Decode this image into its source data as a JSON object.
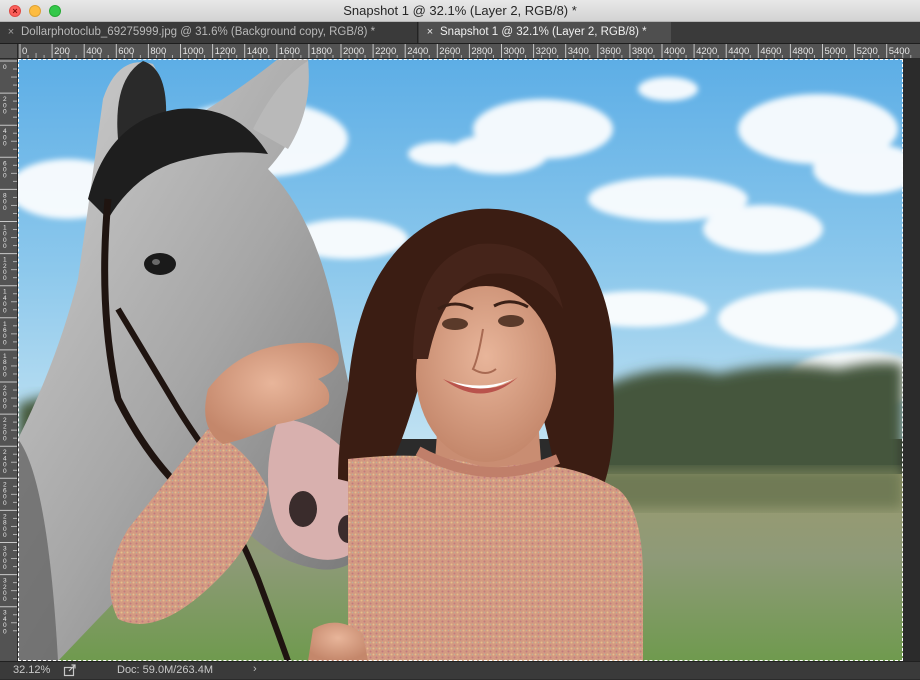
{
  "window": {
    "title": "Snapshot 1 @ 32.1% (Layer 2, RGB/8) *"
  },
  "tabs": [
    {
      "label": "Dollarphotoclub_69275999.jpg @ 31.6% (Background copy, RGB/8) *",
      "active": false
    },
    {
      "label": "Snapshot 1 @ 32.1% (Layer 2, RGB/8) *",
      "active": true
    }
  ],
  "ruler": {
    "horizontal_labels": [
      "0",
      "200",
      "400",
      "600",
      "800",
      "1000",
      "1200",
      "1400",
      "1600",
      "1800",
      "2000",
      "2200",
      "2400",
      "2600",
      "2800",
      "3000",
      "3200",
      "3400",
      "3600",
      "3800",
      "4000",
      "4200",
      "4400",
      "4600",
      "4800",
      "5000",
      "5200",
      "5400"
    ],
    "vertical_labels": [
      "0",
      "200",
      "400",
      "600",
      "800",
      "1000",
      "1200",
      "1400",
      "1600",
      "1800",
      "2000",
      "2200",
      "2400",
      "2600",
      "2800",
      "3000",
      "3200",
      "3400"
    ]
  },
  "status": {
    "zoom": "32.12%",
    "doc_info": "Doc: 59.0M/263.4M",
    "arrow": "›"
  },
  "colors": {
    "ui_dark": "#2b2b2b",
    "ruler": "#535353",
    "active_tab": "#4f4f4f",
    "sky": "#7ec1e9",
    "hair": "#3b1d13",
    "sweater": "#d79a83"
  },
  "icons": {
    "close": "close-icon",
    "minimize": "minimize-icon",
    "maximize": "maximize-icon",
    "tab_close": "tab-close-icon",
    "share": "share-icon",
    "status_arrow": "chevron-right-icon"
  }
}
